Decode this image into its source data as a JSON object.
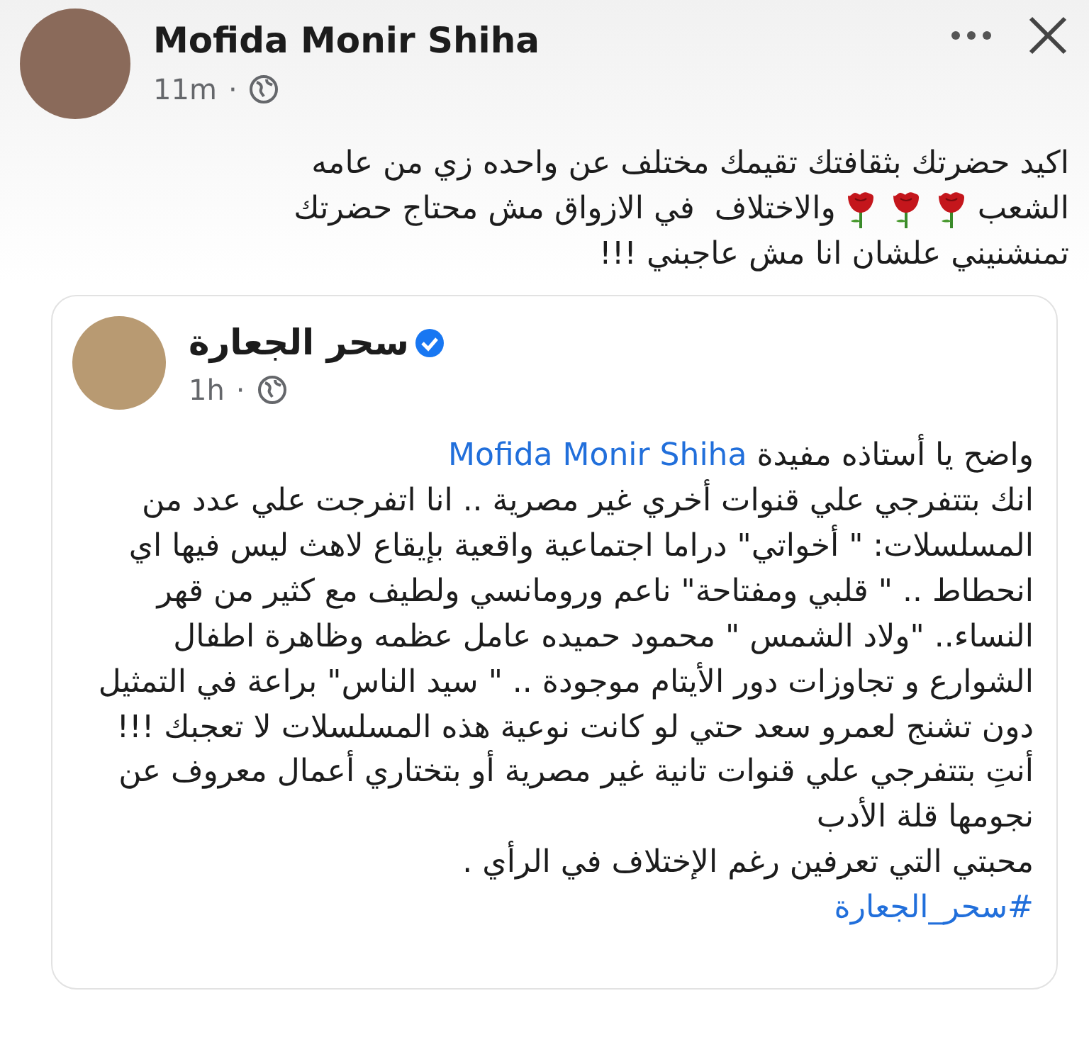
{
  "post": {
    "author": "Mofida Monir Shiha",
    "time": "11m",
    "separator": "·",
    "lines": [
      [
        {
          "kind": "text",
          "text": "اكيد حضرتك بثقافتك تقيمك مختلف عن واحده زي من عامه"
        }
      ],
      [
        {
          "kind": "text",
          "text": "الشعب"
        },
        {
          "kind": "rose"
        },
        {
          "kind": "rose"
        },
        {
          "kind": "rose"
        },
        {
          "kind": "text",
          "text": "والاختلاف  في الازواق مش محتاج حضرتك"
        }
      ],
      [
        {
          "kind": "text",
          "text": "تمنشنيني علشان انا مش عاجبني !!!"
        }
      ]
    ]
  },
  "shared_post": {
    "author": "سحر الجعارة",
    "verified": true,
    "time": "1h",
    "separator": "·",
    "greeting": {
      "text": "واضح يا أستاذه مفيدة",
      "mention": "Mofida Monir Shiha"
    },
    "paragraphs": [
      "انك بتتفرجي علي قنوات أخري غير مصرية .. انا اتفرجت علي عدد من المسلسلات: \" أخواتي\" دراما اجتماعية واقعية بإيقاع لاهث ليس فيها اي انحطاط .. \" قلبي ومفتاحة\" ناعم ورومانسي ولطيف مع كثير من قهر النساء.. \"ولاد الشمس \" محمود حميده عامل عظمه وظاهرة اطفال الشوارع و تجاوزات دور الأيتام موجودة .. \" سيد الناس\" براعة في التمثيل دون تشنج لعمرو سعد حتي لو كانت نوعية هذه المسلسلات لا تعجبك !!!",
      "أنتِ بتتفرجي علي قنوات تانية غير مصرية أو بتختاري أعمال معروف عن نجومها قلة الأدب",
      "محبتي التي تعرفين رغم الإختلاف في الرأي ."
    ],
    "hashtag": "#سحر_الجعارة"
  }
}
